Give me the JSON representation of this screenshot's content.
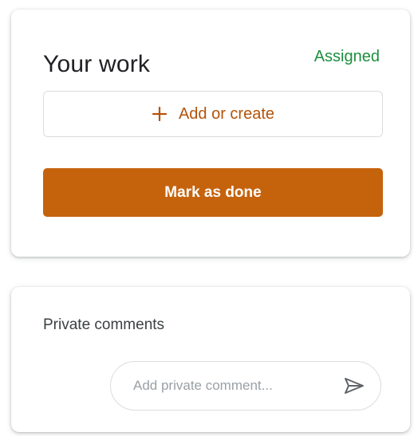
{
  "your_work": {
    "title": "Your work",
    "status": "Assigned",
    "add_label": "Add or create",
    "mark_done_label": "Mark as done"
  },
  "private_comments": {
    "title": "Private comments",
    "placeholder": "Add private comment...",
    "value": ""
  },
  "colors": {
    "status_green": "#1e8e3e",
    "accent_orange": "#c5630d",
    "add_text_orange": "#b45309"
  },
  "icons": {
    "add": "plus-icon",
    "send": "send-icon"
  }
}
